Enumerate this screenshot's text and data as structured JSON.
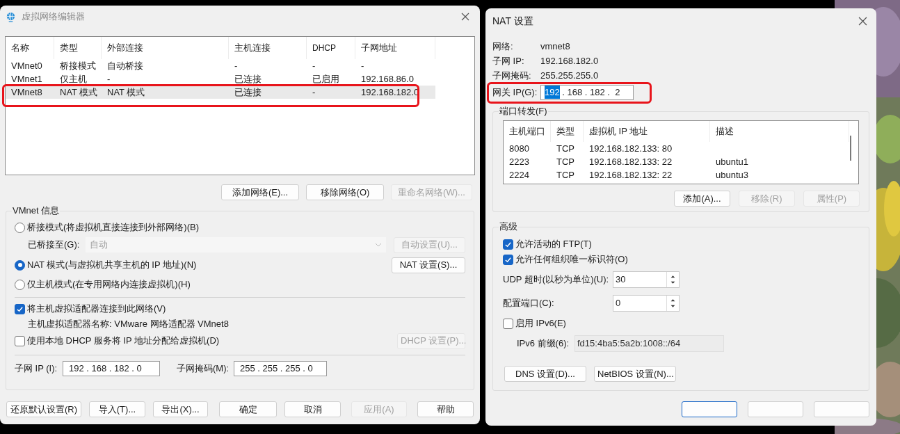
{
  "network_editor": {
    "title": "虚拟网络编辑器",
    "table": {
      "columns": [
        "名称",
        "类型",
        "外部连接",
        "主机连接",
        "DHCP",
        "子网地址"
      ],
      "rows": [
        {
          "cells": [
            "VMnet0",
            "桥接模式",
            "自动桥接",
            "-",
            "-",
            "-"
          ],
          "selected": false
        },
        {
          "cells": [
            "VMnet1",
            "仅主机",
            "-",
            "已连接",
            "已启用",
            "192.168.86.0"
          ],
          "selected": false
        },
        {
          "cells": [
            "VMnet8",
            "NAT 模式",
            "NAT 模式",
            "已连接",
            "-",
            "192.168.182.0"
          ],
          "selected": true
        }
      ]
    },
    "list_buttons": [
      {
        "label": "添加网络(E)...",
        "disabled": false
      },
      {
        "label": "移除网络(O)",
        "disabled": false
      },
      {
        "label": "重命名网络(W)...",
        "disabled": true
      }
    ],
    "vmnet_info": {
      "title": "VMnet 信息",
      "bridged_radio": {
        "label": "桥接模式(将虚拟机直接连接到外部网络)(B)",
        "selected": false
      },
      "bridged_to": {
        "label": "已桥接至(G):",
        "value": "自动",
        "disabled": true
      },
      "auto_button": {
        "label": "自动设置(U)...",
        "disabled": true
      },
      "nat_radio": {
        "label": "NAT 模式(与虚拟机共享主机的 IP 地址)(N)",
        "selected": true
      },
      "nat_button": {
        "label": "NAT 设置(S)...",
        "disabled": false
      },
      "host_only_radio": {
        "label": "仅主机模式(在专用网络内连接虚拟机)(H)",
        "selected": false
      },
      "connect_adapter": {
        "label": "将主机虚拟适配器连接到此网络(V)",
        "checked": true
      },
      "adapter_name": "主机虚拟适配器名称: VMware 网络适配器 VMnet8",
      "dhcp_check": {
        "label": "使用本地 DHCP 服务将 IP 地址分配给虚拟机(D)",
        "checked": false
      },
      "dhcp_button": {
        "label": "DHCP 设置(P)...",
        "disabled": true
      },
      "subnet_ip": {
        "label": "子网 IP (I):",
        "value": "192 . 168 . 182 . 0"
      },
      "subnet_mask": {
        "label": "子网掩码(M):",
        "value": "255 . 255 . 255 . 0"
      }
    },
    "footer_buttons": [
      {
        "label": "还原默认设置(R)",
        "disabled": false
      },
      {
        "label": "导入(T)...",
        "disabled": false
      },
      {
        "label": "导出(X)...",
        "disabled": false
      },
      {
        "label": "确定",
        "disabled": false
      },
      {
        "label": "取消",
        "disabled": false
      },
      {
        "label": "应用(A)",
        "disabled": true
      },
      {
        "label": "帮助",
        "disabled": false
      }
    ]
  },
  "nat_settings": {
    "title": "NAT 设置",
    "info": [
      {
        "label": "网络:",
        "value": "vmnet8"
      },
      {
        "label": "子网 IP:",
        "value": "192.168.182.0"
      },
      {
        "label": "子网掩码:",
        "value": "255.255.255.0"
      }
    ],
    "gateway": {
      "label": "网关 IP(G):",
      "value_parts": [
        {
          "text": "192",
          "selected": true
        },
        {
          "text": " . 168 . 182 .  2",
          "selected": false
        }
      ]
    },
    "port_forwarding": {
      "title": "端口转发(F)",
      "columns": [
        "主机端口",
        "类型",
        "虚拟机 IP 地址",
        "描述"
      ],
      "rows": [
        [
          "8080",
          "TCP",
          "192.168.182.133: 80",
          ""
        ],
        [
          "2223",
          "TCP",
          "192.168.182.133: 22",
          "ubuntu1"
        ],
        [
          "2224",
          "TCP",
          "192.168.182.132: 22",
          "ubuntu3"
        ]
      ],
      "buttons": [
        {
          "label": "添加(A)...",
          "disabled": false
        },
        {
          "label": "移除(R)",
          "disabled": true
        },
        {
          "label": "属性(P)",
          "disabled": true
        }
      ]
    },
    "advanced": {
      "title": "高级",
      "checks": [
        {
          "label": "允许活动的 FTP(T)",
          "checked": true
        },
        {
          "label": "允许任何组织唯一标识符(O)",
          "checked": true
        }
      ],
      "udp_timeout": {
        "label": "UDP 超时(以秒为单位)(U):",
        "value": "30"
      },
      "config_port": {
        "label": "配置端口(C):",
        "value": "0"
      },
      "ipv6": {
        "label": "启用 IPv6(E)",
        "checked": false
      },
      "ipv6_prefix": {
        "label": "IPv6 前缀(6):",
        "value": "fd15:4ba5:5a2b:1008::/64",
        "disabled": true
      },
      "buttons": [
        "DNS 设置(D)...",
        "NetBIOS 设置(N)..."
      ]
    }
  }
}
